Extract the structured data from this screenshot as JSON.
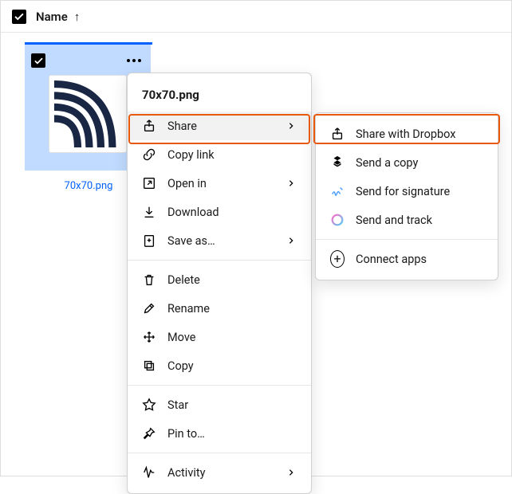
{
  "header": {
    "column": "Name",
    "sort_dir": "↑"
  },
  "file": {
    "name": "70x70.png"
  },
  "menu": {
    "title": "70x70.png",
    "share": "Share",
    "copy_link": "Copy link",
    "open_in": "Open in",
    "download": "Download",
    "save_as": "Save as…",
    "delete": "Delete",
    "rename": "Rename",
    "move": "Move",
    "copy": "Copy",
    "star": "Star",
    "pin_to": "Pin to…",
    "activity": "Activity"
  },
  "submenu": {
    "share_dropbox": "Share with Dropbox",
    "send_copy": "Send a copy",
    "send_signature": "Send for signature",
    "send_track": "Send and track",
    "connect_apps": "Connect apps"
  }
}
